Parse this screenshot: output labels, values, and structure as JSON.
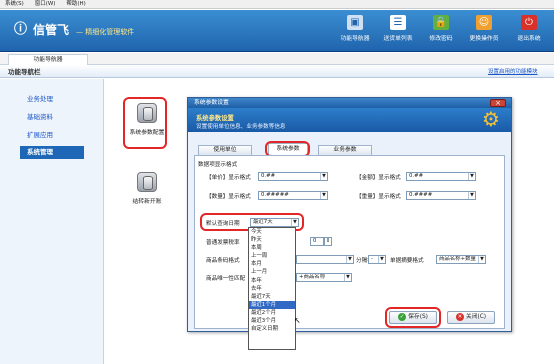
{
  "menubar": {
    "items": [
      "系统(S)",
      "窗口(W)",
      "帮助(H)"
    ]
  },
  "header": {
    "logo": "信管飞",
    "tagline": "— 精细化管理软件",
    "toolbar": [
      {
        "label": "功能导航器",
        "icon": "navigator-icon"
      },
      {
        "label": "送货单列表",
        "icon": "list-icon"
      },
      {
        "label": "修改密码",
        "icon": "key-lock-icon"
      },
      {
        "label": "更换操作员",
        "icon": "user-icon"
      },
      {
        "label": "退出系统",
        "icon": "power-icon"
      }
    ]
  },
  "tabs": {
    "active": "功能导航器"
  },
  "nav": {
    "title": "功能导航栏",
    "link": "设置启用的功能模块"
  },
  "sidebar": {
    "items": [
      "业务处理",
      "基础资料",
      "扩展应用",
      "系统管理"
    ],
    "active": "系统管理"
  },
  "features": [
    {
      "label": "系统参数配置"
    },
    {
      "label": "结转新开账"
    }
  ],
  "dialog": {
    "title": "系统参数设置",
    "heading": "系统参数设置",
    "subheading": "设置使用单位信息、业务参数等信息",
    "tabs": [
      "使用单位",
      "系统参数",
      "业务参数"
    ],
    "active_tab": "系统参数",
    "section_title": "数据项显示格式",
    "fields": {
      "unit_price_label": "【单价】显示格式",
      "unit_price_value": "0.##",
      "amount_label": "【金额】显示格式",
      "amount_value": "0.##",
      "quantity_label": "【数量】显示格式",
      "quantity_value": "0.#####",
      "weight_label": "【重量】显示格式",
      "weight_value": "0.####",
      "default_query_label": "默认查询日期",
      "default_query_value": "最近7天",
      "invoice_row_label": "普通发票税率",
      "invoice_row_value": "0",
      "barcode_label": "商品条码格式",
      "barcode_value": "",
      "separator_label": "分隔符",
      "separator_value": "-",
      "print_label": "单据摘要格式",
      "print_value": "商品名称+数量",
      "unique_label": "商品唯一性匹配",
      "unique_value": "+商品名称"
    },
    "dropdown_options": [
      "今天",
      "昨天",
      "本周",
      "上一周",
      "本月",
      "上一月",
      "本年",
      "去年",
      "最近7天",
      "最近1个月",
      "最近2个月",
      "最近3个月",
      "自定义日期"
    ],
    "dropdown_selected": "最近1个月",
    "save_button": "保存(S)",
    "close_button": "关闭(C)"
  },
  "colors": {
    "header": "#1f64ae",
    "accent_red": "#e32626",
    "selection": "#3168c4"
  }
}
